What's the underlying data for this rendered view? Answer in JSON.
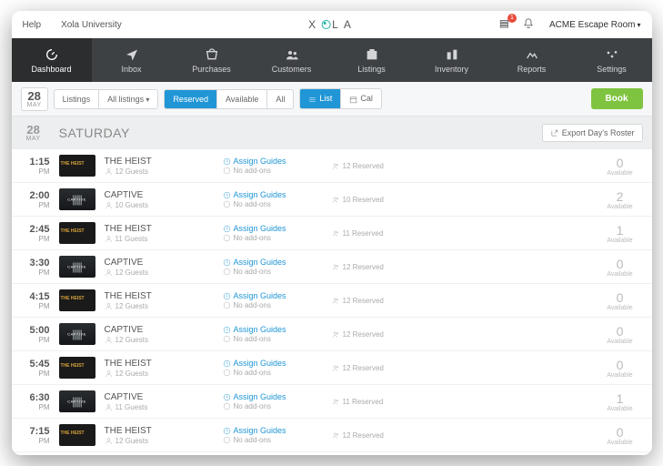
{
  "top": {
    "help": "Help",
    "uni": "Xola University",
    "notif_count": "1",
    "company": "ACME Escape Room"
  },
  "logo": {
    "x": "X",
    "l": "L",
    "a": "A"
  },
  "nav": [
    {
      "label": "Dashboard",
      "active": true
    },
    {
      "label": "Inbox"
    },
    {
      "label": "Purchases"
    },
    {
      "label": "Customers"
    },
    {
      "label": "Listings"
    },
    {
      "label": "Inventory"
    },
    {
      "label": "Reports"
    },
    {
      "label": "Settings"
    }
  ],
  "filter": {
    "day": "28",
    "month": "MAY",
    "listings": "Listings",
    "all_listings": "All listings",
    "reserved": "Reserved",
    "available": "Available",
    "all": "All",
    "list": "List",
    "cal": "Cal",
    "book": "Book"
  },
  "dayhead": {
    "day": "28",
    "month": "MAY",
    "name": "SATURDAY",
    "export": "Export Day's Roster"
  },
  "labels": {
    "assign": "Assign Guides",
    "noadd": "No add-ons",
    "available": "Available",
    "reserved": "Reserved",
    "guests": "Guests"
  },
  "rows": [
    {
      "time": "1:15",
      "ap": "PM",
      "name": "THE HEIST",
      "kind": "heist",
      "guests": 12,
      "reserved": 12,
      "avail": 0
    },
    {
      "time": "2:00",
      "ap": "PM",
      "name": "CAPTIVE",
      "kind": "captive",
      "guests": 10,
      "reserved": 10,
      "avail": 2
    },
    {
      "time": "2:45",
      "ap": "PM",
      "name": "THE HEIST",
      "kind": "heist",
      "guests": 11,
      "reserved": 11,
      "avail": 1
    },
    {
      "time": "3:30",
      "ap": "PM",
      "name": "CAPTIVE",
      "kind": "captive",
      "guests": 12,
      "reserved": 12,
      "avail": 0
    },
    {
      "time": "4:15",
      "ap": "PM",
      "name": "THE HEIST",
      "kind": "heist",
      "guests": 12,
      "reserved": 12,
      "avail": 0
    },
    {
      "time": "5:00",
      "ap": "PM",
      "name": "CAPTIVE",
      "kind": "captive",
      "guests": 12,
      "reserved": 12,
      "avail": 0
    },
    {
      "time": "5:45",
      "ap": "PM",
      "name": "THE HEIST",
      "kind": "heist",
      "guests": 12,
      "reserved": 12,
      "avail": 0
    },
    {
      "time": "6:30",
      "ap": "PM",
      "name": "CAPTIVE",
      "kind": "captive",
      "guests": 11,
      "reserved": 11,
      "avail": 1
    },
    {
      "time": "7:15",
      "ap": "PM",
      "name": "THE HEIST",
      "kind": "heist",
      "guests": 12,
      "reserved": 12,
      "avail": 0
    }
  ]
}
